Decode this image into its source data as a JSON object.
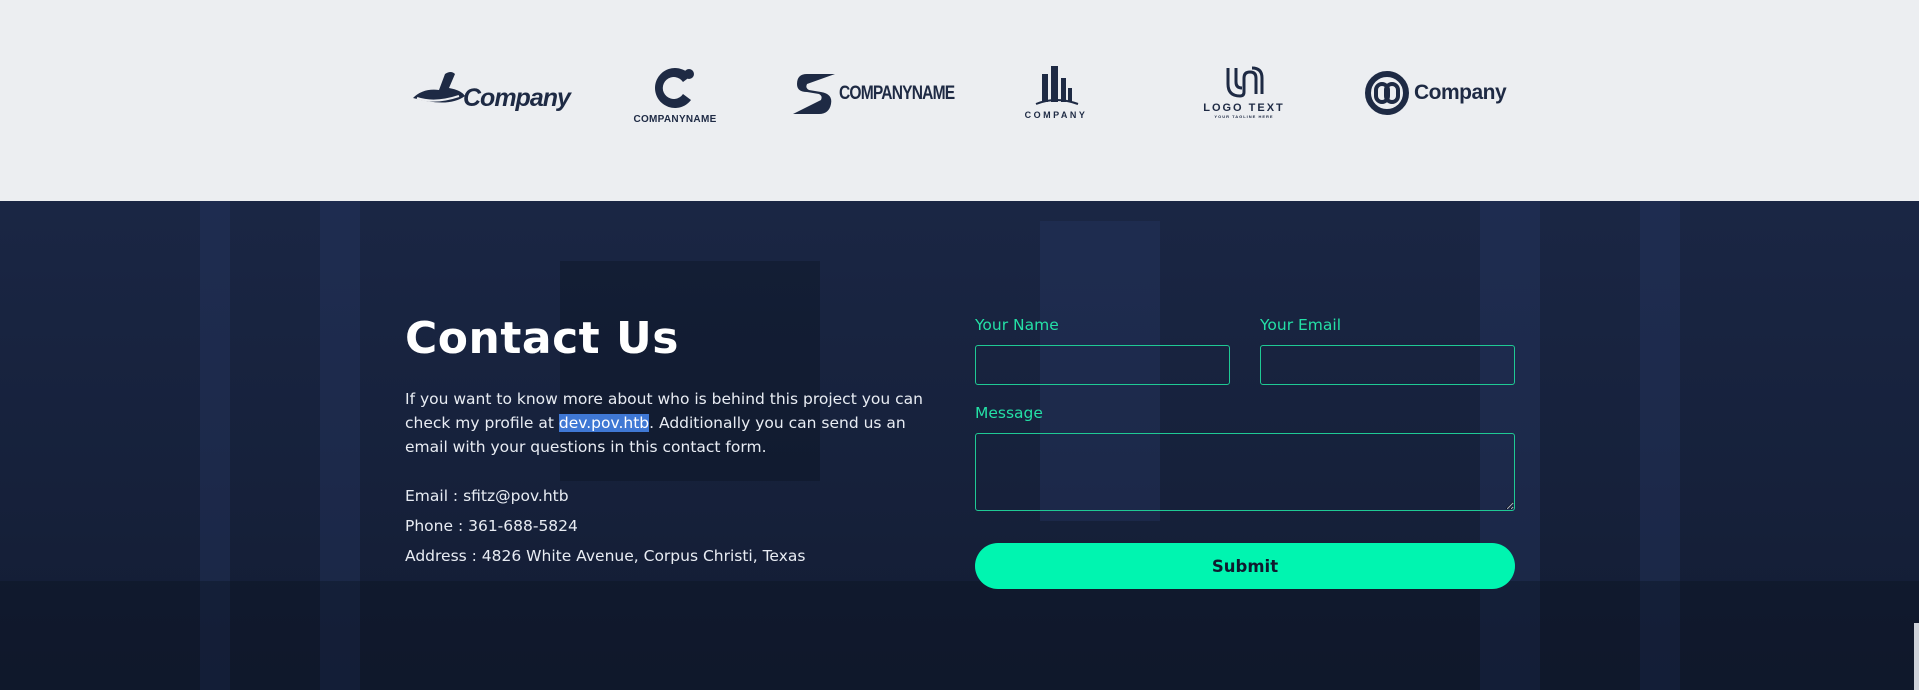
{
  "logos": [
    {
      "icon": "hat-icon",
      "text": "Company"
    },
    {
      "icon": "c-mark-icon",
      "text": "COMPANYNAME"
    },
    {
      "icon": "s-mark-icon",
      "text": "COMPANYNAME"
    },
    {
      "icon": "buildings-icon",
      "text": "COMPANY"
    },
    {
      "icon": "u-mark-icon",
      "text": "LOGO TEXT",
      "tagline": "YOUR TAGLINE HERE"
    },
    {
      "icon": "linked-rings-icon",
      "text": "Company"
    }
  ],
  "contact": {
    "title": "Contact Us",
    "para_before": "If you want to know more about who is behind this project you can check my profile at ",
    "para_link": "dev.pov.htb",
    "para_after": ". Additionally you can send us an email with your questions in this contact form.",
    "email": "Email : sfitz@pov.htb",
    "phone": "Phone : 361-688-5824",
    "address": "Address : 4826 White Avenue, Corpus Christi, Texas"
  },
  "form": {
    "name_label": "Your Name",
    "email_label": "Your Email",
    "message_label": "Message",
    "name_value": "",
    "email_value": "",
    "message_value": "",
    "submit_label": "Submit"
  },
  "colors": {
    "accent": "#00f5b0",
    "label": "#24e0a6",
    "background": "#16213b",
    "logo_band": "#eceef1",
    "selection": "#3f78d4"
  }
}
